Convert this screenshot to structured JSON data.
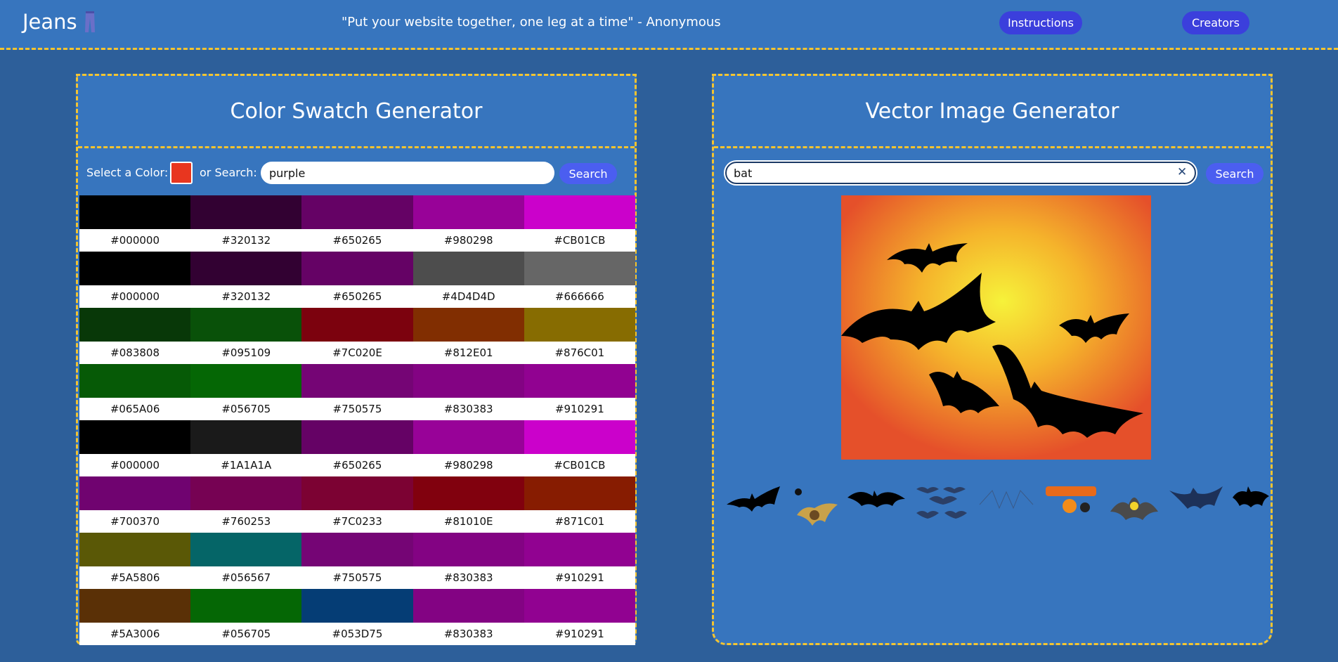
{
  "header": {
    "logo": "Jeans",
    "logo_icon": "jeans-icon",
    "quote": "\"Put your website together, one leg at a time\" - Anonymous",
    "nav": {
      "instructions": "Instructions",
      "creators": "Creators"
    }
  },
  "colors": {
    "accent_border": "#f4c430",
    "panel": "#3775be",
    "page": "#2d5f9a",
    "button": "#4b5ef0"
  },
  "swatch": {
    "title": "Color Swatch Generator",
    "select_label": "Select a Color:",
    "selected_color": "#e8361f",
    "or_label": "or Search:",
    "search_value": "purple",
    "search_button": "Search",
    "rows": [
      [
        "#000000",
        "#320132",
        "#650265",
        "#980298",
        "#CB01CB"
      ],
      [
        "#000000",
        "#320132",
        "#650265",
        "#4D4D4D",
        "#666666"
      ],
      [
        "#083808",
        "#095109",
        "#7C020E",
        "#812E01",
        "#876C01"
      ],
      [
        "#065A06",
        "#056705",
        "#750575",
        "#830383",
        "#910291"
      ],
      [
        "#000000",
        "#1A1A1A",
        "#650265",
        "#980298",
        "#CB01CB"
      ],
      [
        "#700370",
        "#760253",
        "#7C0233",
        "#81010E",
        "#871C01"
      ],
      [
        "#5A5806",
        "#056567",
        "#750575",
        "#830383",
        "#910291"
      ],
      [
        "#5A3006",
        "#056705",
        "#053D75",
        "#830383",
        "#910291"
      ]
    ]
  },
  "vector": {
    "title": "Vector Image Generator",
    "search_value": "bat",
    "clear_icon": "close-icon",
    "search_button": "Search",
    "main_image": "bats-over-orange-moon",
    "thumbnails": [
      "bat",
      "bat-with-spider",
      "bat",
      "bat-swarm",
      "bat-skeleton",
      "halloween-text-pumpkin",
      "cartoon-bat",
      "blue-bat",
      "bat"
    ]
  }
}
